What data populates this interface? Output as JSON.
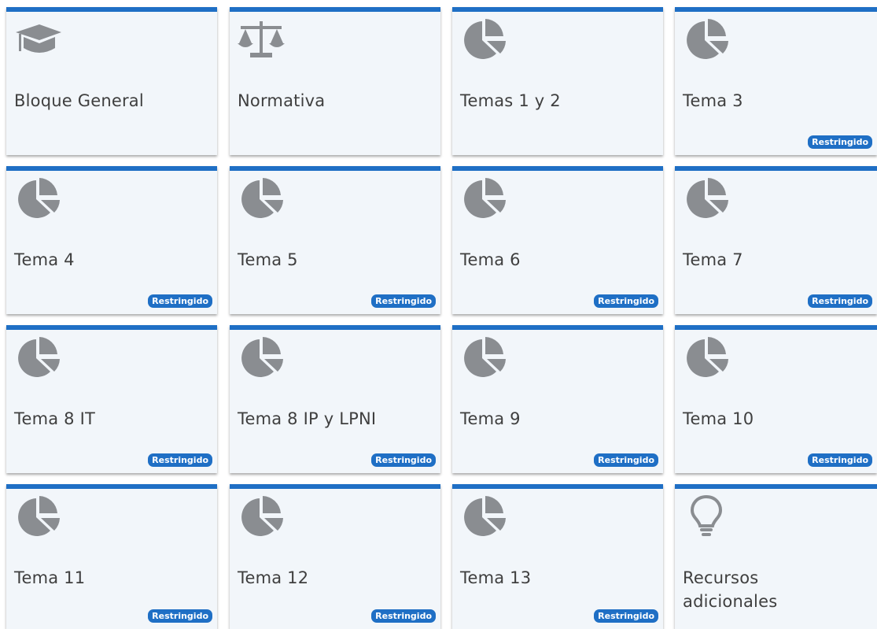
{
  "badge_label": "Restringido",
  "colors": {
    "accent": "#1f6fc5",
    "tile_bg": "#f2f6fa",
    "icon": "#8a8d91"
  },
  "tiles": [
    {
      "label": "Bloque General",
      "icon": "graduation-cap-icon"
    },
    {
      "label": "Normativa",
      "icon": "balance-scale-icon"
    },
    {
      "label": "Temas 1 y 2",
      "icon": "pie-chart-icon"
    },
    {
      "label": "Tema 3",
      "icon": "pie-chart-icon",
      "restricted": true
    },
    {
      "label": "Tema 4",
      "icon": "pie-chart-icon",
      "restricted": true
    },
    {
      "label": "Tema 5",
      "icon": "pie-chart-icon",
      "restricted": true
    },
    {
      "label": "Tema 6",
      "icon": "pie-chart-icon",
      "restricted": true
    },
    {
      "label": "Tema 7",
      "icon": "pie-chart-icon",
      "restricted": true
    },
    {
      "label": "Tema 8 IT",
      "icon": "pie-chart-icon",
      "restricted": true
    },
    {
      "label": "Tema 8 IP y LPNI",
      "icon": "pie-chart-icon",
      "restricted": true
    },
    {
      "label": "Tema 9",
      "icon": "pie-chart-icon",
      "restricted": true
    },
    {
      "label": "Tema 10",
      "icon": "pie-chart-icon",
      "restricted": true
    },
    {
      "label": "Tema 11",
      "icon": "pie-chart-icon",
      "restricted": true
    },
    {
      "label": "Tema 12",
      "icon": "pie-chart-icon",
      "restricted": true
    },
    {
      "label": "Tema 13",
      "icon": "pie-chart-icon",
      "restricted": true
    },
    {
      "label": "Recursos adicionales",
      "icon": "lightbulb-icon"
    }
  ]
}
